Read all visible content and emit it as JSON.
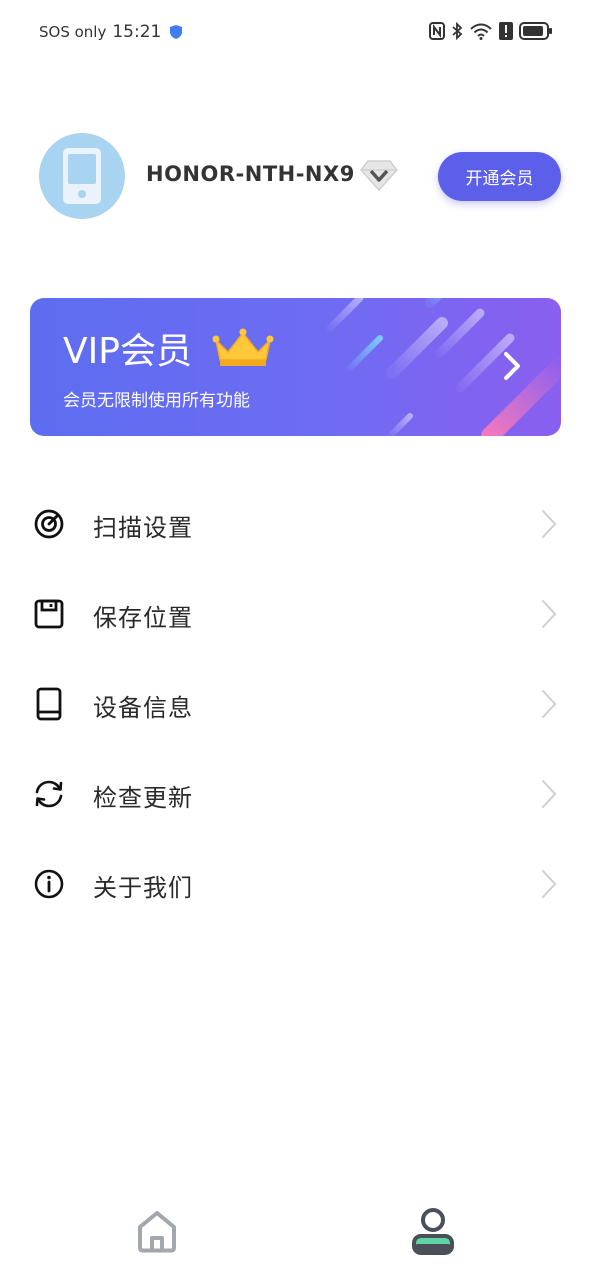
{
  "status_bar": {
    "carrier": "SOS only",
    "time": "15:21",
    "icons": [
      "shield-icon",
      "nfc-icon",
      "bluetooth-icon",
      "wifi-icon",
      "alert-icon",
      "battery-icon"
    ]
  },
  "profile": {
    "device_name": "HONOR-NTH-NX9",
    "avatar_icon": "phone-icon",
    "badge_icon": "diamond-icon",
    "open_vip_label": "开通会员"
  },
  "vip_banner": {
    "title": "VIP会员",
    "subtitle": "会员无限制使用所有功能",
    "icon": "crown-icon"
  },
  "menu": {
    "items": [
      {
        "label": "扫描设置",
        "icon": "scan-icon"
      },
      {
        "label": "保存位置",
        "icon": "save-icon"
      },
      {
        "label": "设备信息",
        "icon": "device-icon"
      },
      {
        "label": "检查更新",
        "icon": "refresh-icon"
      },
      {
        "label": "关于我们",
        "icon": "info-icon"
      }
    ]
  },
  "bottom_nav": {
    "items": [
      {
        "name": "home",
        "icon": "home-icon",
        "active": false
      },
      {
        "name": "profile",
        "icon": "person-icon",
        "active": true
      }
    ]
  },
  "colors": {
    "accent": "#5b5fe9",
    "avatar_bg": "#a9d4f1",
    "banner_start": "#5d6df0",
    "banner_end": "#8a5ff0",
    "nav_active": "#5fd3a5"
  }
}
